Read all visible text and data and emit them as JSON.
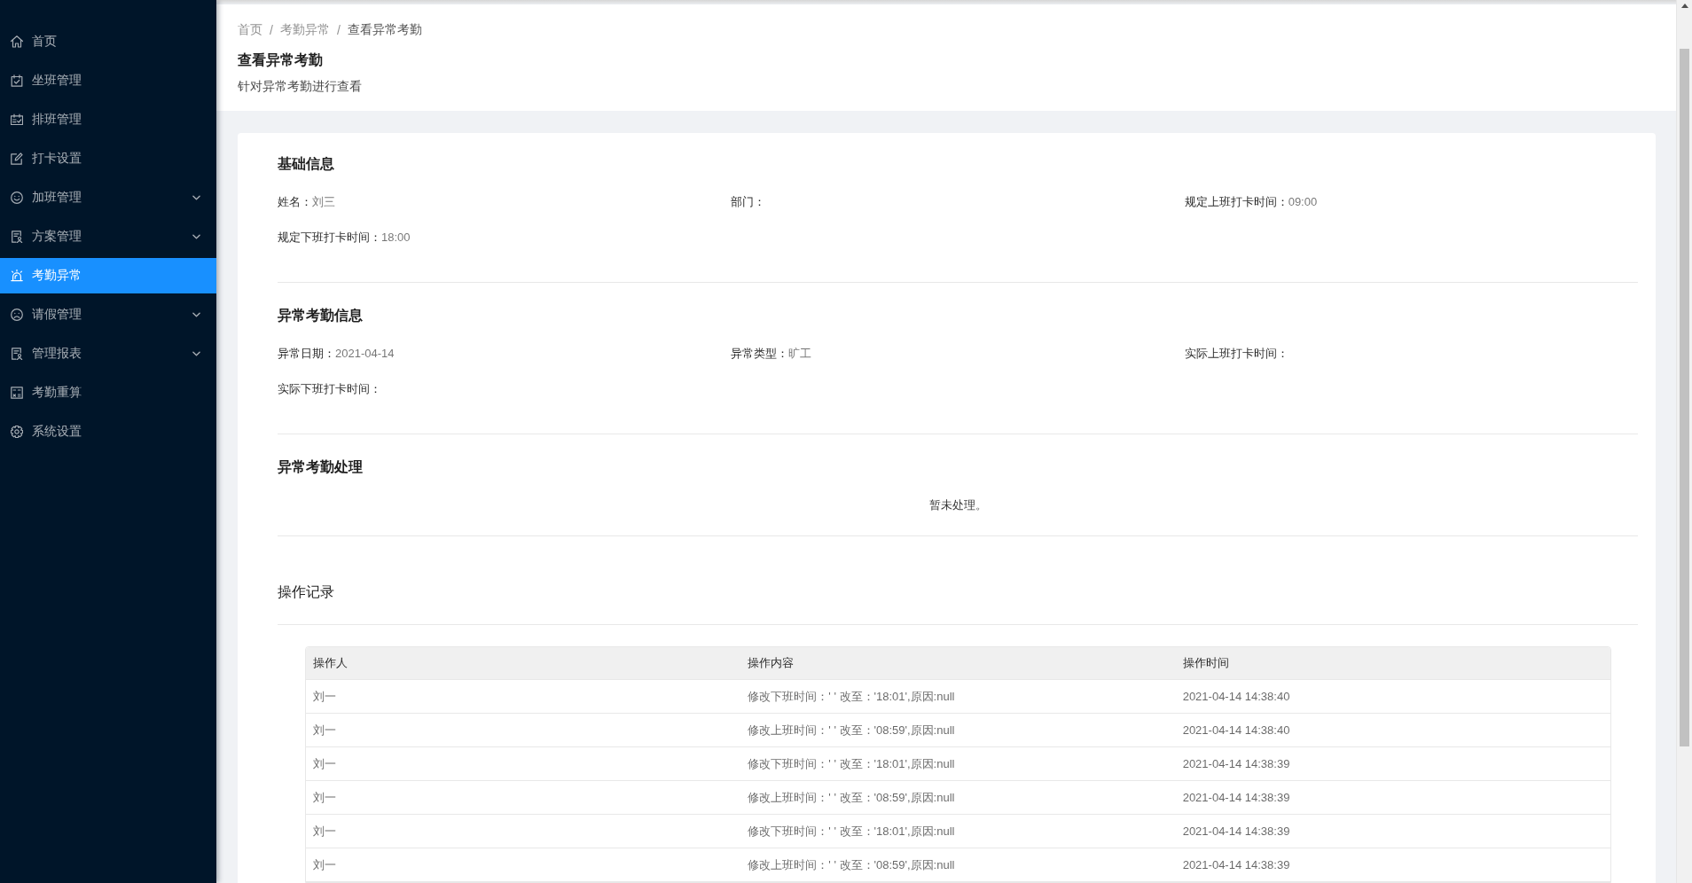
{
  "sidebar": {
    "items": [
      {
        "label": "首页",
        "kind": "item",
        "selected": false
      },
      {
        "label": "坐班管理",
        "kind": "item",
        "selected": false
      },
      {
        "label": "排班管理",
        "kind": "item",
        "selected": false
      },
      {
        "label": "打卡设置",
        "kind": "item",
        "selected": false
      },
      {
        "label": "加班管理",
        "kind": "submenu",
        "selected": false
      },
      {
        "label": "方案管理",
        "kind": "submenu",
        "selected": false
      },
      {
        "label": "考勤异常",
        "kind": "item",
        "selected": true
      },
      {
        "label": "请假管理",
        "kind": "submenu",
        "selected": false
      },
      {
        "label": "管理报表",
        "kind": "submenu",
        "selected": false
      },
      {
        "label": "考勤重算",
        "kind": "item",
        "selected": false
      },
      {
        "label": "系统设置",
        "kind": "item",
        "selected": false
      }
    ]
  },
  "page_header": {
    "breadcrumb": {
      "items": [
        {
          "label": "首页",
          "current": false
        },
        {
          "label": "考勤异常",
          "current": false
        },
        {
          "label": "查看异常考勤",
          "current": true
        }
      ],
      "separators": [
        "/",
        "/"
      ]
    },
    "title": "查看异常考勤",
    "subtitle": "针对异常考勤进行查看"
  },
  "sections": [
    {
      "kind": "fields",
      "title": "基础信息",
      "fields": [
        {
          "label": "姓名：",
          "value": "刘三"
        },
        {
          "label": "部门："
        },
        {
          "label": "规定上班打卡时间：",
          "value": "09:00"
        },
        {
          "label": "规定下班打卡时间：",
          "value": "18:00"
        }
      ]
    },
    {
      "kind": "fields",
      "title": "异常考勤信息",
      "fields": [
        {
          "label": "异常日期：",
          "value": "2021-04-14"
        },
        {
          "label": "异常类型：",
          "value": "旷工"
        },
        {
          "label": "实际上班打卡时间："
        },
        {
          "label": "实际下班打卡时间："
        }
      ]
    },
    {
      "kind": "message",
      "title": "异常考勤处理",
      "message": "暂未处理。"
    },
    {
      "kind": "table",
      "title": "操作记录",
      "columns": [
        "操作人",
        "操作内容",
        "操作时间"
      ],
      "rows": [
        [
          "刘一",
          "修改下班时间：' ' 改至：'18:01',原因:null",
          "2021-04-14 14:38:40"
        ],
        [
          "刘一",
          "修改上班时间：' ' 改至：'08:59',原因:null",
          "2021-04-14 14:38:40"
        ],
        [
          "刘一",
          "修改下班时间：' ' 改至：'18:01',原因:null",
          "2021-04-14 14:38:39"
        ],
        [
          "刘一",
          "修改上班时间：' ' 改至：'08:59',原因:null",
          "2021-04-14 14:38:39"
        ],
        [
          "刘一",
          "修改下班时间：' ' 改至：'18:01',原因:null",
          "2021-04-14 14:38:39"
        ],
        [
          "刘一",
          "修改上班时间：' ' 改至：'08:59',原因:null",
          "2021-04-14 14:38:39"
        ]
      ]
    }
  ]
}
